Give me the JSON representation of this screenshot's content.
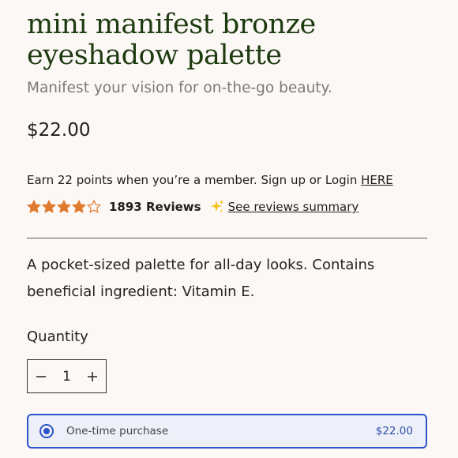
{
  "product": {
    "title": "mini manifest bronze eyeshadow palette",
    "tagline": "Manifest your vision for on-the-go beauty.",
    "price": "$22.00",
    "description": "A pocket-sized palette for all-day looks. Contains beneficial ingredient: Vitamin E."
  },
  "rewards": {
    "text": "Earn 22 points when you’re a member. Sign up or Login ",
    "link_label": "HERE"
  },
  "reviews": {
    "rating": 4,
    "rating_max": 5,
    "count_label": "1893 Reviews",
    "summary_link": "See reviews summary",
    "star_color": "#e07a2e"
  },
  "quantity": {
    "label": "Quantity",
    "value": "1",
    "decrement_icon": "minus-icon",
    "increment_icon": "plus-icon"
  },
  "purchase_options": {
    "selected": {
      "label": "One-time purchase",
      "price": "$22.00"
    }
  },
  "colors": {
    "title": "#1e3a10",
    "accent": "#2b55c9",
    "background": "#fcf8f6"
  }
}
